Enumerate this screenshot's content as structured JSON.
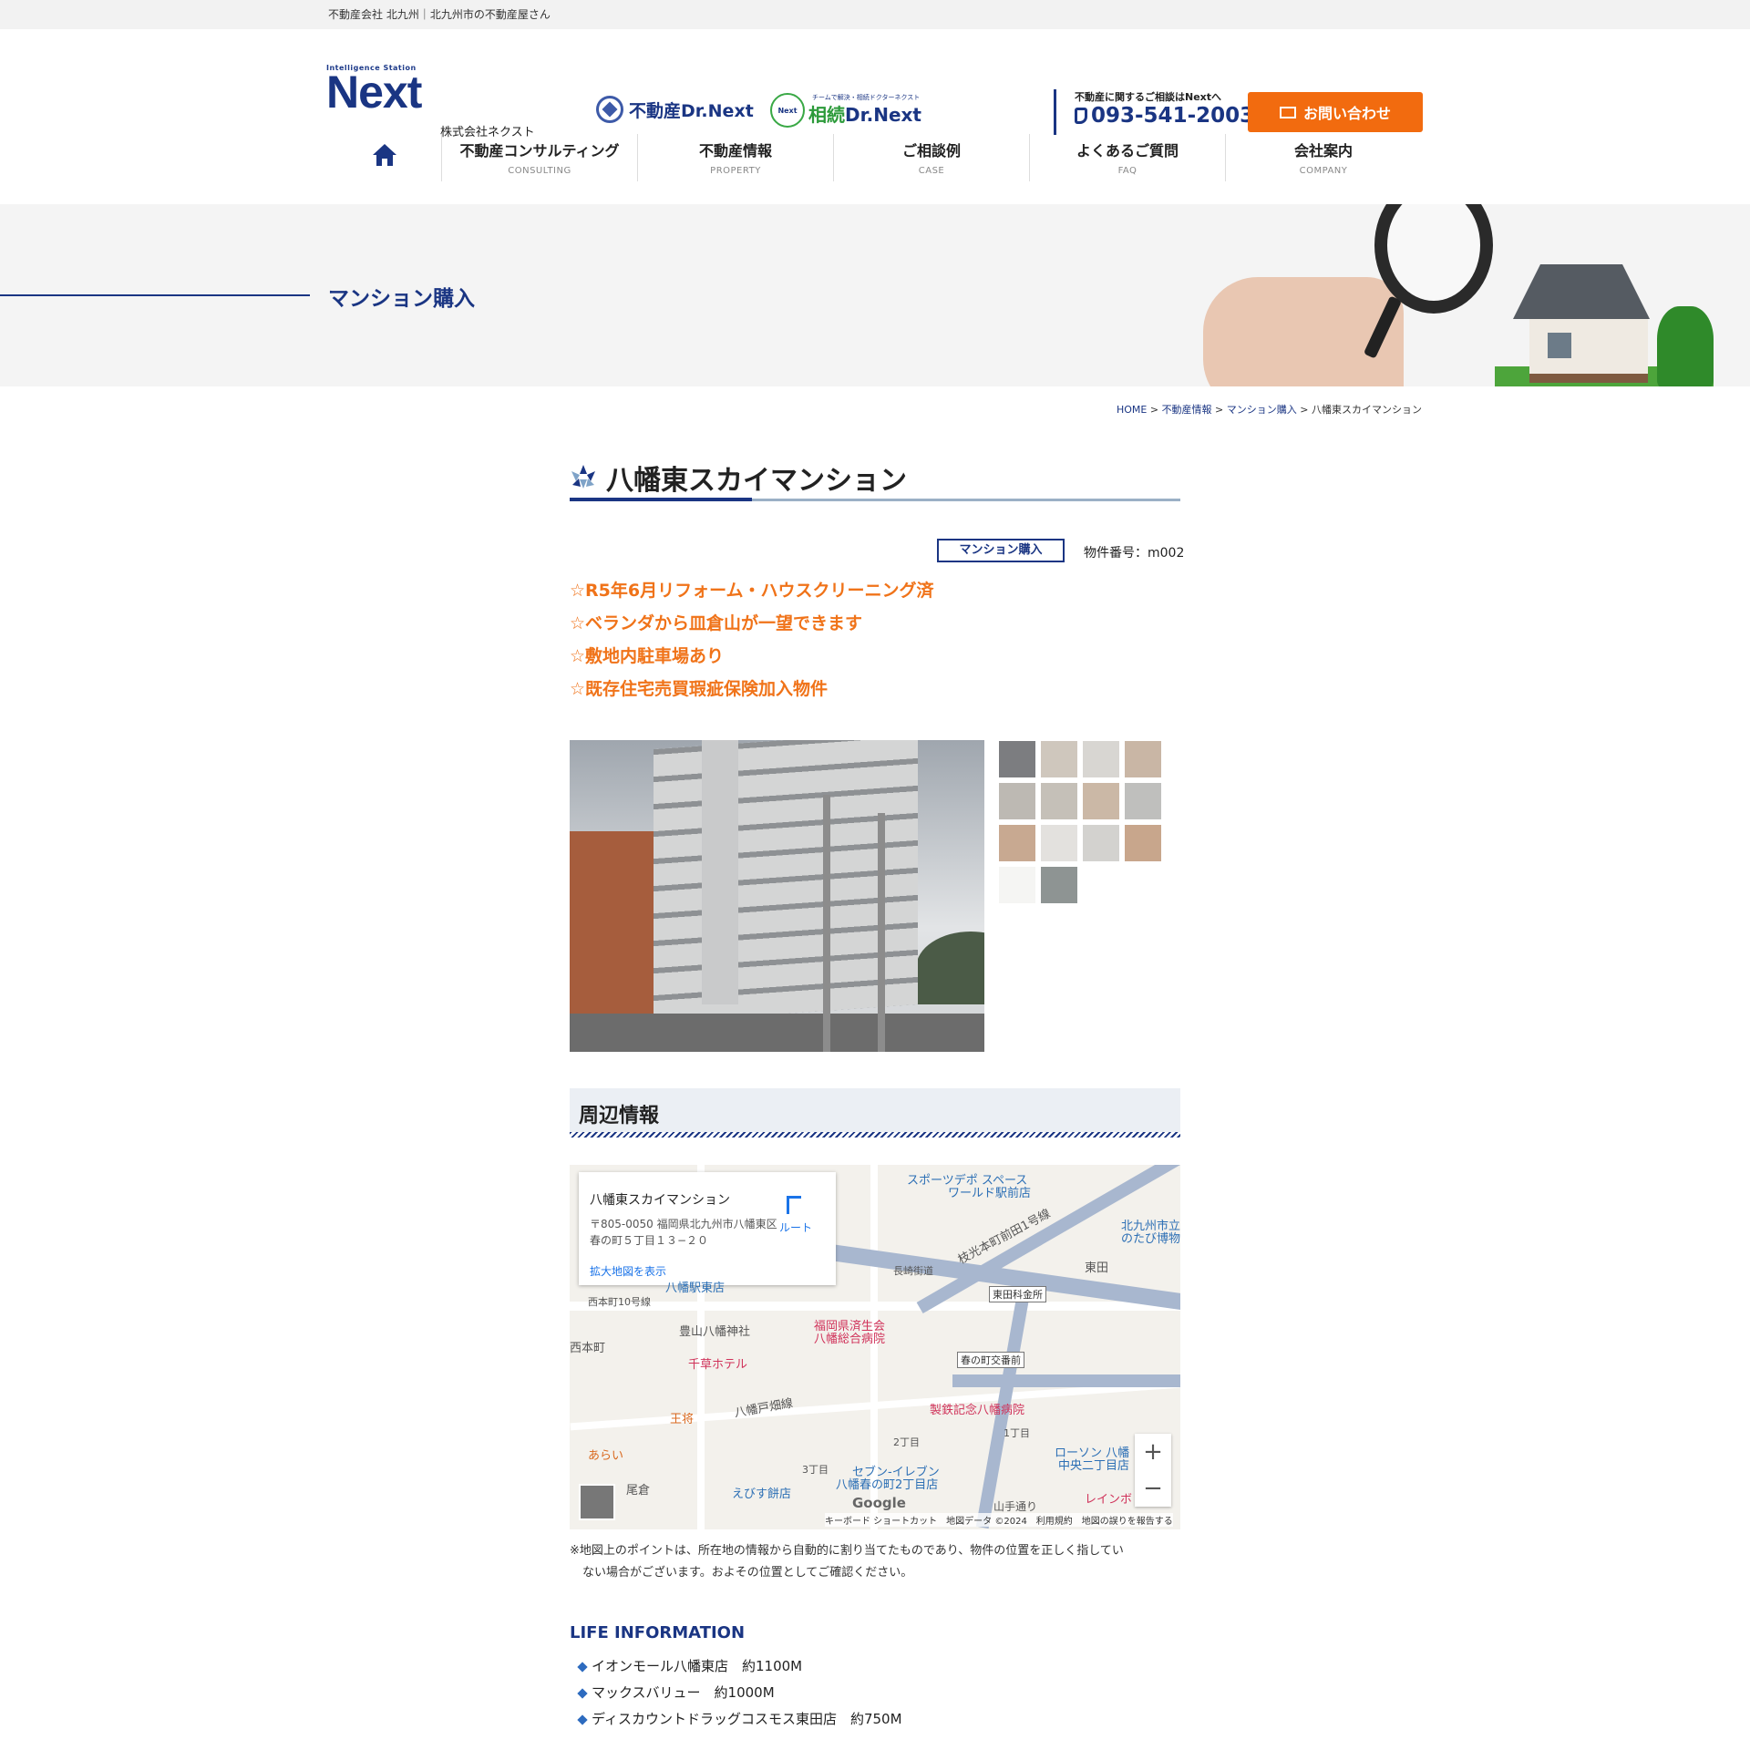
{
  "topbar": {
    "text": "不動産会社 北九州｜北九州市の不動産屋さん"
  },
  "header": {
    "logo_small": "Intelligence Station",
    "logo_big": "Next",
    "logo_corp": "株式会社ネクスト",
    "brand1": "不動産Dr.Next",
    "brand2_tag": "チームで解決・相続ドクターネクスト",
    "brand2_mark": "Next",
    "brand2_a": "相続",
    "brand2_b": "Dr.Next",
    "tel_caption": "不動産に関するご相談はNextへ",
    "tel_number": "093-541-2003",
    "contact_label": "お問い合わせ"
  },
  "nav": {
    "items": [
      {
        "jp": "不動産コンサルティング",
        "en": "CONSULTING"
      },
      {
        "jp": "不動産情報",
        "en": "PROPERTY"
      },
      {
        "jp": "ご相談例",
        "en": "CASE"
      },
      {
        "jp": "よくあるご質問",
        "en": "FAQ"
      },
      {
        "jp": "会社案内",
        "en": "COMPANY"
      }
    ]
  },
  "hero": {
    "title": "マンション購入"
  },
  "breadcrumb": {
    "home": "HOME",
    "sep": " > ",
    "c1": "不動産情報",
    "c2": "マンション購入",
    "current": "八幡東スカイマンション"
  },
  "property": {
    "title": "八幡東スカイマンション",
    "category": "マンション購入",
    "id": "物件番号：m002",
    "features": [
      "☆R5年6月リフォーム・ハウスクリーニング済",
      "☆ベランダから皿倉山が一望できます",
      "☆敷地内駐車場あり",
      "☆既存住宅売買瑕疵保険加入物件"
    ]
  },
  "surroundings": {
    "title": "周辺情報"
  },
  "map": {
    "card_name": "八幡東スカイマンション",
    "card_addr1": "〒805-0050 福岡県北九州市八幡東区",
    "card_addr2": "春の町５丁目１３−２０",
    "card_route": "ルート",
    "card_link": "拡大地図を表示",
    "labels": {
      "l1": "スポーツデポ スペース",
      "l2": "ワールド駅前店",
      "l3": "枝光本町前田1号線",
      "l4": "北九州市立",
      "l5": "のたび博物",
      "l6": "長崎街道",
      "l7": "東田",
      "l8": "東田科金所",
      "l9": "西本町10号線",
      "l10": "豊山八幡神社",
      "l11": "福岡県済生会",
      "l12": "八幡総合病院",
      "l13": "西本町",
      "l14": "千草ホテル",
      "l15": "春の町交番前",
      "l16": "八幡戸畑線",
      "l17": "王将",
      "l18": "製鉄記念八幡病院",
      "l19": "1丁目",
      "l20": "2丁目",
      "l21": "あらい",
      "l22": "3丁目",
      "l23": "セブン-イレブン",
      "l24": "八幡春の町2丁目店",
      "l25": "ローソン 八幡",
      "l26": "中央二丁目店",
      "l27": "尾倉",
      "l28": "えびす餅店",
      "l29": "山手通り",
      "l30": "レインボ",
      "l31": "八幡駅東店"
    },
    "zoom_in": "+",
    "zoom_out": "−",
    "google": "Google",
    "footer": "キーボード ショートカット　地図データ ©2024　利用規約　地図の誤りを報告する"
  },
  "note": {
    "line1": "※地図上のポイントは、所在地の情報から自動的に割り当てたものであり、物件の位置を正しく指してい",
    "line2": "ない場合がございます。およその位置としてご確認ください。"
  },
  "life": {
    "title": "LIFE INFORMATION",
    "items": [
      "イオンモール八幡東店　約1100M",
      "マックスバリュー　約1000M",
      "ディスカウントドラッグコスモス東田店　約750M"
    ]
  }
}
